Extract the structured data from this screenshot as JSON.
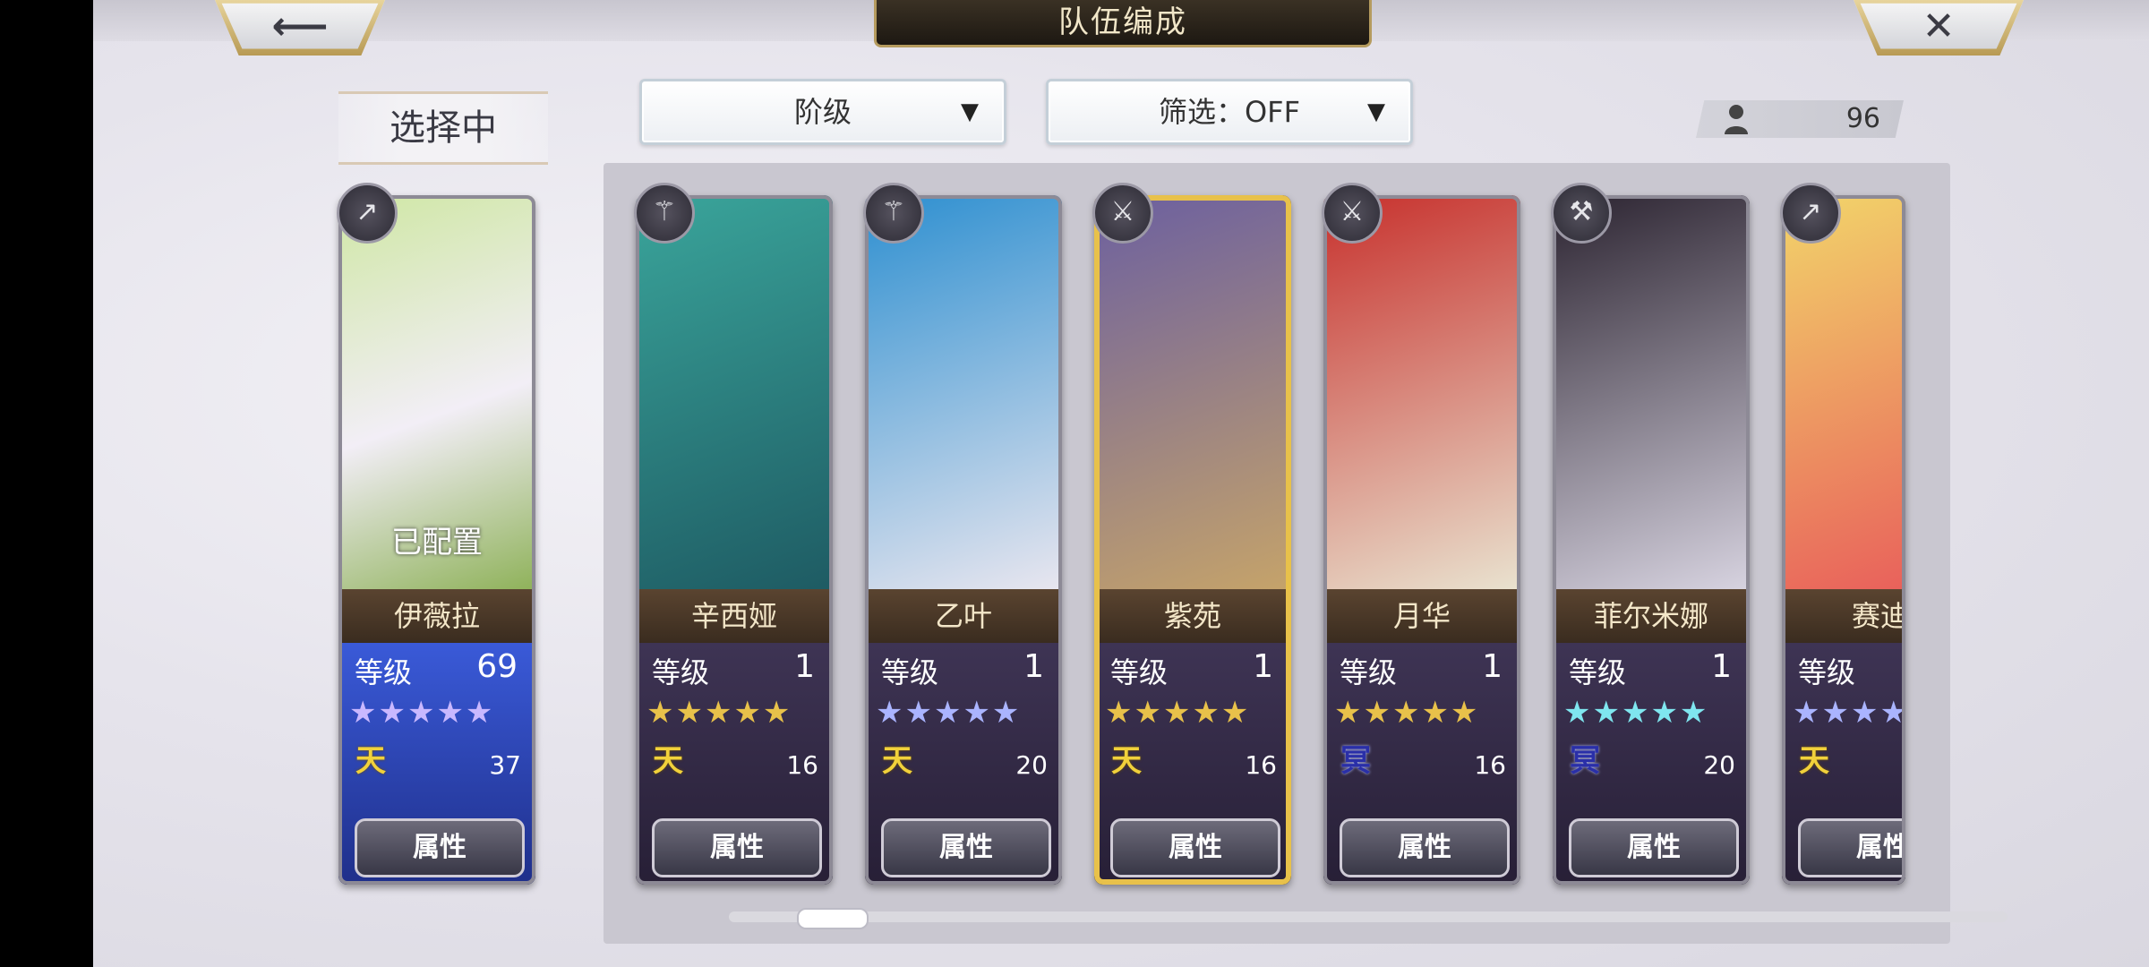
{
  "header": {
    "title": "队伍编成",
    "back_icon": "arrow-left-icon",
    "close_icon": "close-icon"
  },
  "selection": {
    "label": "选择中",
    "card": {
      "name": "伊薇拉",
      "status": "已配置",
      "level_label": "等级",
      "level": "69",
      "stars": "★★★★★",
      "tier": "天",
      "cost": "37",
      "attr_button": "属性",
      "weapon": "spear-icon"
    }
  },
  "filters": {
    "sort": "阶级",
    "filter": "筛选：OFF"
  },
  "unit_count": "96",
  "roster": [
    {
      "name": "辛西娅",
      "level_label": "等级",
      "level": "1",
      "stars": "★★★★★",
      "star_color": "#e8c14a",
      "tier": "天",
      "tier_style": "gold",
      "cost": "16",
      "attr_button": "属性",
      "weapon": "staff-icon"
    },
    {
      "name": "乙叶",
      "level_label": "等级",
      "level": "1",
      "stars": "★★★★★",
      "star_color": "#aab4ff",
      "tier": "天",
      "tier_style": "gold",
      "cost": "20",
      "attr_button": "属性",
      "weapon": "staff-icon"
    },
    {
      "name": "紫苑",
      "level_label": "等级",
      "level": "1",
      "stars": "★★★★★",
      "star_color": "#e8c14a",
      "tier": "天",
      "tier_style": "gold",
      "cost": "16",
      "attr_button": "属性",
      "weapon": "sword-icon",
      "selected": true
    },
    {
      "name": "月华",
      "level_label": "等级",
      "level": "1",
      "stars": "★★★★★",
      "star_color": "#e8c14a",
      "tier": "冥",
      "tier_style": "navy",
      "cost": "16",
      "attr_button": "属性",
      "weapon": "sword-icon"
    },
    {
      "name": "菲尔米娜",
      "level_label": "等级",
      "level": "1",
      "stars": "★★★★★",
      "star_color": "#7fe6ef",
      "tier": "冥",
      "tier_style": "navy",
      "cost": "20",
      "attr_button": "属性",
      "weapon": "axe-icon"
    },
    {
      "name": "赛迪",
      "level_label": "等级",
      "level": "",
      "stars": "★★★★★",
      "star_color": "#aab4ff",
      "tier": "天",
      "tier_style": "gold",
      "cost": "",
      "attr_button": "属性",
      "weapon": "spear-icon"
    }
  ],
  "portrait_colors": [
    [
      "#cfe7a4",
      "#8fb25a"
    ],
    [
      "#3aa59b",
      "#1e5b63"
    ],
    [
      "#2d8fd0",
      "#e8e6ef"
    ],
    [
      "#6b5fa0",
      "#c5a36a"
    ],
    [
      "#c7302c",
      "#e9e2cf"
    ],
    [
      "#2b2330",
      "#d7d3e0"
    ],
    [
      "#f2d56a",
      "#e85a5a"
    ]
  ]
}
